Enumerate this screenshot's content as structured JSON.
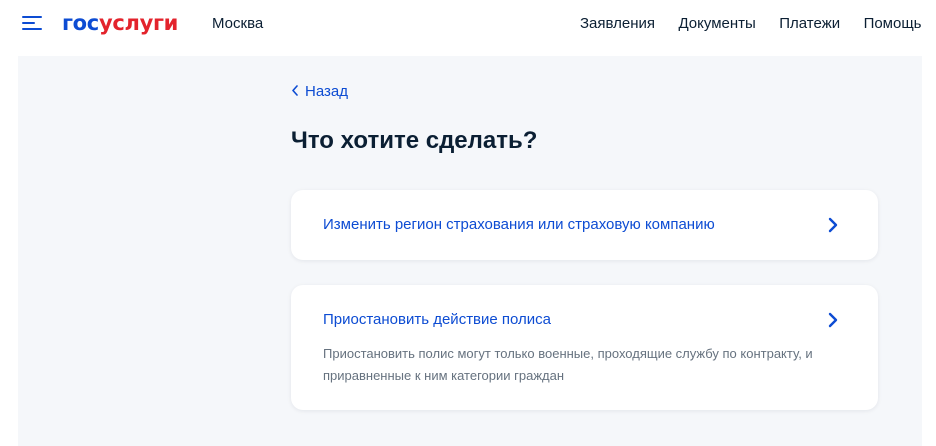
{
  "header": {
    "logo_part1": "гос",
    "logo_part2": "услуги",
    "city": "Москва",
    "nav": [
      "Заявления",
      "Документы",
      "Платежи",
      "Помощь"
    ]
  },
  "page": {
    "back_label": "Назад",
    "title": "Что хотите сделать?"
  },
  "options": [
    {
      "title": "Изменить регион страхования или страховую компанию"
    },
    {
      "title": "Приостановить действие полиса",
      "description": "Приостановить полис могут только военные, проходящие службу по контракту, и приравненные к ним категории граждан"
    }
  ],
  "colors": {
    "brand_blue": "#0d4cd3",
    "brand_red": "#e3232c",
    "text_dark": "#0b1f33",
    "text_muted": "#66727f",
    "page_bg": "#f5f7fa"
  },
  "icons": {
    "menu": "menu-icon",
    "back": "chevron-left-icon",
    "option_arrow": "chevron-right-icon"
  }
}
